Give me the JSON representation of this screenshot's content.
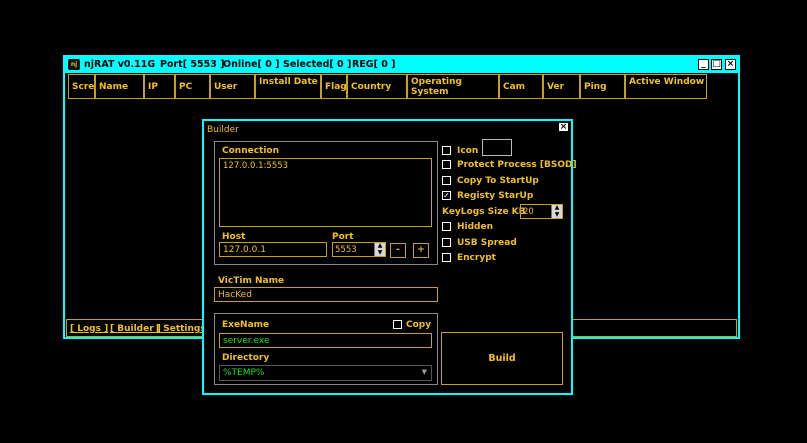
{
  "titlebar": {
    "app_title": "njRAT v0.11G",
    "port": "Port[ 5553 ]",
    "online": "Online[ 0 ]",
    "selected": "Selected[ 0 ]",
    "reg": "REG[ 0 ]",
    "icon_text": "nj"
  },
  "columns": [
    "Scree",
    "Name",
    "IP",
    "PC",
    "User",
    "Install Date",
    "Flag",
    "Country",
    "Operating System",
    "Cam",
    "Ver",
    "Ping",
    "Active Window"
  ],
  "bottom_links": {
    "logs": "[ Logs ]",
    "builder": "[ Builder ]",
    "settings": "[ Settings ]"
  },
  "builder": {
    "title": "Builder",
    "connection_label": "Connection",
    "connection_entry": "127.0.0.1:5553",
    "host_label": "Host",
    "host_value": "127.0.0.1",
    "port_label": "Port",
    "port_value": "5553",
    "minus": "-",
    "plus": "+",
    "victim_label": "VicTim Name",
    "victim_value": "HacKed",
    "exename_label": "ExeName",
    "copy_label": "Copy",
    "exename_value": "server.exe",
    "directory_label": "Directory",
    "directory_value": "%TEMP%",
    "icon_label": "Icon",
    "protect_label": "Protect Process [BSOD]",
    "copy_startup_label": "Copy To StartUp",
    "registry_label": "Registy StarUp",
    "keylogs_label": "KeyLogs Size KB",
    "keylogs_value": "20",
    "hidden_label": "Hidden",
    "usb_label": "USB Spread",
    "encrypt_label": "Encrypt",
    "build_label": "Build"
  },
  "colors": {
    "accent": "#00ffff",
    "text": "#f0c020",
    "value_green": "#20e020"
  }
}
